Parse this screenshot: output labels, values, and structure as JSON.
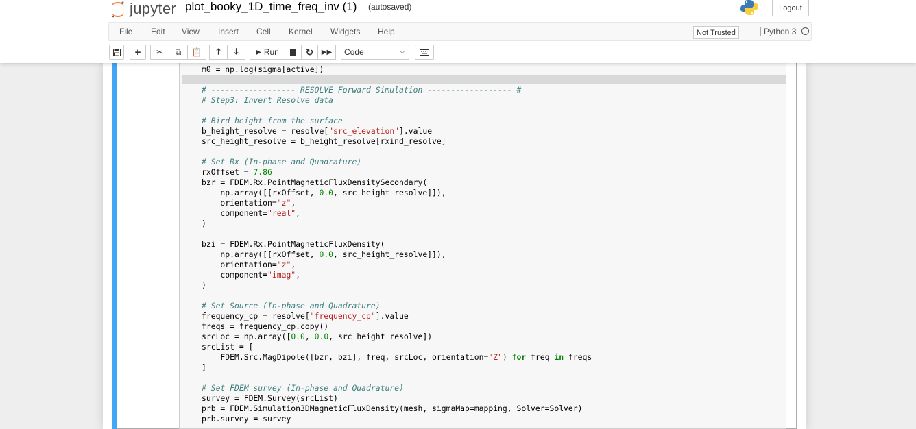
{
  "header": {
    "logo_text": "jupyter",
    "notebook_name": "plot_booky_1D_time_freq_inv (1)",
    "autosave_status": "(autosaved)",
    "logout_label": "Logout"
  },
  "menubar": {
    "items": [
      "File",
      "Edit",
      "View",
      "Insert",
      "Cell",
      "Kernel",
      "Widgets",
      "Help"
    ],
    "trust_label": "Not Trusted",
    "kernel_name": "Python 3"
  },
  "toolbar": {
    "run_label": "Run",
    "cell_type": "Code",
    "buttons": [
      "save-icon",
      "plus-icon",
      "scissors-icon",
      "copy-icon",
      "paste-icon",
      "arrow-up-icon",
      "arrow-down-icon",
      "run-icon",
      "stop-icon",
      "restart-icon",
      "fast-forward-icon",
      "keyboard-icon"
    ]
  },
  "colors": {
    "accent": "#42a5f5",
    "comment": "#408080",
    "string": "#ba2121",
    "number": "#008800",
    "keyword": "#008000"
  },
  "code_lines": [
    [
      [
        "",
        "m0 = np.log(sigma[active])"
      ]
    ],
    [
      [
        "cm",
        "# ------------------ RESOLVE Forward Simulation ------------------ #"
      ]
    ],
    [
      [
        "cm",
        "# Step3: Invert Resolve data"
      ]
    ],
    [],
    [
      [
        "cm",
        "# Bird height from the surface"
      ]
    ],
    [
      [
        "",
        "b_height_resolve = resolve["
      ],
      [
        "st",
        "\"src_elevation\""
      ],
      [
        "",
        "].value"
      ]
    ],
    [
      [
        "",
        "src_height_resolve = b_height_resolve[rxind_resolve]"
      ]
    ],
    [],
    [
      [
        "cm",
        "# Set Rx (In-phase and Quadrature)"
      ]
    ],
    [
      [
        "",
        "rxOffset = "
      ],
      [
        "nu",
        "7.86"
      ]
    ],
    [
      [
        "",
        "bzr = FDEM.Rx.PointMagneticFluxDensitySecondary("
      ]
    ],
    [
      [
        "",
        "    np.array([[rxOffset, "
      ],
      [
        "nu",
        "0.0"
      ],
      [
        "",
        ", src_height_resolve]]),"
      ]
    ],
    [
      [
        "",
        "    orientation="
      ],
      [
        "st",
        "\"z\""
      ],
      [
        "",
        ","
      ]
    ],
    [
      [
        "",
        "    component="
      ],
      [
        "st",
        "\"real\""
      ],
      [
        "",
        ","
      ]
    ],
    [
      [
        "",
        ")"
      ]
    ],
    [],
    [
      [
        "",
        "bzi = FDEM.Rx.PointMagneticFluxDensity("
      ]
    ],
    [
      [
        "",
        "    np.array([[rxOffset, "
      ],
      [
        "nu",
        "0.0"
      ],
      [
        "",
        ", src_height_resolve]]),"
      ]
    ],
    [
      [
        "",
        "    orientation="
      ],
      [
        "st",
        "\"z\""
      ],
      [
        "",
        ","
      ]
    ],
    [
      [
        "",
        "    component="
      ],
      [
        "st",
        "\"imag\""
      ],
      [
        "",
        ","
      ]
    ],
    [
      [
        "",
        ")"
      ]
    ],
    [],
    [
      [
        "cm",
        "# Set Source (In-phase and Quadrature)"
      ]
    ],
    [
      [
        "",
        "frequency_cp = resolve["
      ],
      [
        "st",
        "\"frequency_cp\""
      ],
      [
        "",
        "].value"
      ]
    ],
    [
      [
        "",
        "freqs = frequency_cp.copy()"
      ]
    ],
    [
      [
        "",
        "srcLoc = np.array(["
      ],
      [
        "nu",
        "0.0"
      ],
      [
        "",
        ", "
      ],
      [
        "nu",
        "0.0"
      ],
      [
        "",
        ", src_height_resolve])"
      ]
    ],
    [
      [
        "",
        "srcList = ["
      ]
    ],
    [
      [
        "",
        "    FDEM.Src.MagDipole([bzr, bzi], freq, srcLoc, orientation="
      ],
      [
        "st",
        "\"Z\""
      ],
      [
        "",
        ") "
      ],
      [
        "kw",
        "for"
      ],
      [
        "",
        " freq "
      ],
      [
        "kw",
        "in"
      ],
      [
        "",
        " freqs"
      ]
    ],
    [
      [
        "",
        "]"
      ]
    ],
    [],
    [
      [
        "cm",
        "# Set FDEM survey (In-phase and Quadrature)"
      ]
    ],
    [
      [
        "",
        "survey = FDEM.Survey(srcList)"
      ]
    ],
    [
      [
        "",
        "prb = FDEM.Simulation3DMagneticFluxDensity(mesh, sigmaMap=mapping, Solver=Solver)"
      ]
    ],
    [
      [
        "",
        "prb.survey = survey"
      ]
    ]
  ]
}
